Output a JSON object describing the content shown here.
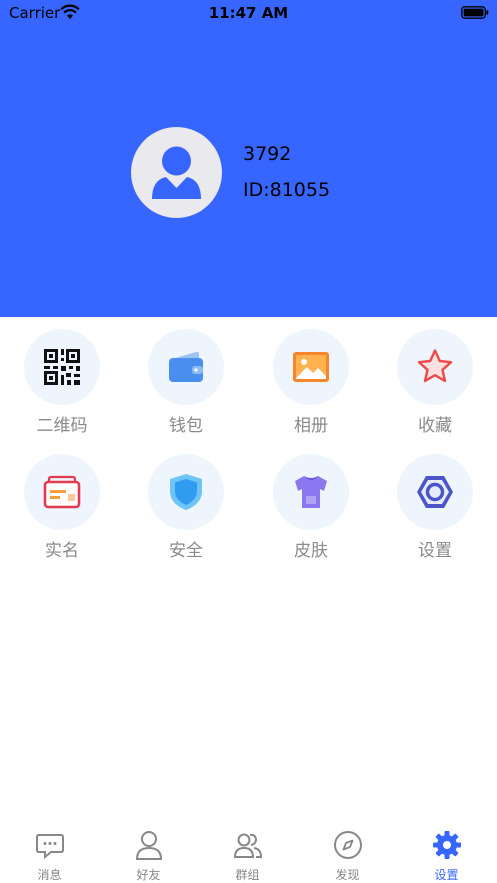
{
  "status_bar": {
    "carrier": "Carrier",
    "time": "11:47 AM"
  },
  "profile": {
    "name": "3792",
    "id": "ID:81055"
  },
  "colors": {
    "header": "#3765ff",
    "accent": "#3765ff"
  },
  "grid": [
    {
      "label": "二维码",
      "icon": "qr-code-icon"
    },
    {
      "label": "钱包",
      "icon": "wallet-icon"
    },
    {
      "label": "相册",
      "icon": "photo-album-icon"
    },
    {
      "label": "收藏",
      "icon": "star-icon"
    },
    {
      "label": "实名",
      "icon": "id-card-icon"
    },
    {
      "label": "安全",
      "icon": "shield-icon"
    },
    {
      "label": "皮肤",
      "icon": "tshirt-icon"
    },
    {
      "label": "设置",
      "icon": "hex-nut-icon"
    }
  ],
  "tabbar": [
    {
      "label": "消息",
      "icon": "message-icon",
      "active": false
    },
    {
      "label": "好友",
      "icon": "person-icon",
      "active": false
    },
    {
      "label": "群组",
      "icon": "group-icon",
      "active": false
    },
    {
      "label": "发现",
      "icon": "compass-icon",
      "active": false
    },
    {
      "label": "设置",
      "icon": "gear-icon",
      "active": true
    }
  ]
}
